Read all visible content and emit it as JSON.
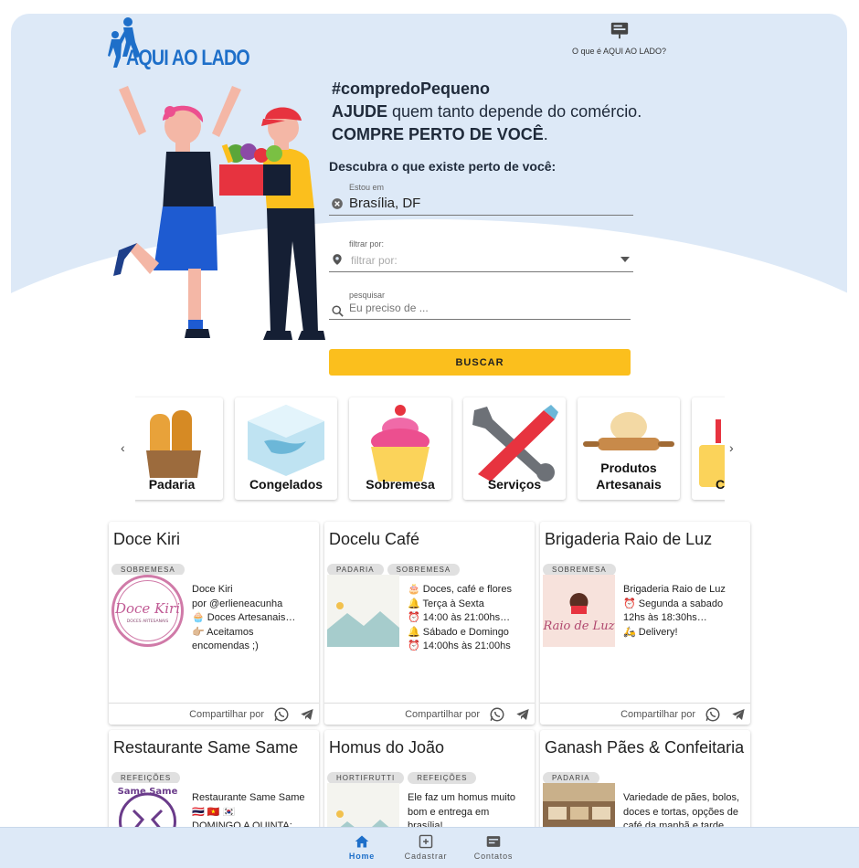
{
  "header": {
    "logo_text": "AQUI AO LADO",
    "about_label": "O que é AQUI AO LADO?"
  },
  "hero": {
    "hashtag": "#compredoPequeno",
    "line2_bold": "AJUDE",
    "line2_rest": " quem tanto depende do comércio.",
    "line3": "COMPRE PERTO DE VOCÊ",
    "line3_end": ".",
    "discover": "Descubra o que existe perto de você:"
  },
  "search": {
    "location_label": "Estou em",
    "location_value": "Brasília, DF",
    "filter_label": "filtrar por:",
    "filter_placeholder": "filtrar por:",
    "query_label": "pesquisar",
    "query_placeholder": "Eu preciso de ...",
    "button_label": "BUSCAR"
  },
  "categories": [
    {
      "label": "Padaria",
      "icon": "bread-icon"
    },
    {
      "label": "Congelados",
      "icon": "ice-cube-icon"
    },
    {
      "label": "Sobremesa",
      "icon": "cupcake-icon"
    },
    {
      "label": "Serviços",
      "icon": "tools-icon"
    },
    {
      "label": "Produtos Artesanais",
      "icon": "rolling-pin-icon"
    },
    {
      "label": "C",
      "icon": "luggage-icon"
    }
  ],
  "stores": [
    {
      "title": "Doce Kiri",
      "chips": [
        "SOBREMESA"
      ],
      "lines": [
        "Doce Kiri",
        "por @erlieneacunha",
        "🧁 Doces Artesanais…",
        "👉🏼 Aceitamos",
        "encomendas ;)"
      ],
      "logo_text": "Doce Kiri",
      "logo_sub": "DOCES ARTESANAIS"
    },
    {
      "title": "Docelu Café",
      "chips": [
        "PADARIA",
        "SOBREMESA"
      ],
      "lines": [
        "🎂 Doces, café e flores",
        "🔔 Terça à Sexta",
        "⏰ 14:00 às 21:00hs…",
        "🔔 Sábado e Domingo",
        "⏰ 14:00hs às 21:00hs"
      ]
    },
    {
      "title": "Brigaderia Raio de Luz",
      "chips": [
        "SOBREMESA"
      ],
      "lines": [
        "Brigaderia Raio de Luz",
        "⏰ Segunda a sabado",
        "12hs às 18:30hs…",
        "🛵 Delivery!"
      ],
      "logo_text": "Raio de Luz"
    },
    {
      "title": "Restaurante Same Same",
      "chips": [
        "REFEIÇÕES"
      ],
      "lines": [
        "Restaurante Same Same",
        "🇹🇭 🇻🇳 🇰🇷",
        "DOMINGO A QUINTA:"
      ],
      "logo_text": "Same Same"
    },
    {
      "title": "Homus do João",
      "chips": [
        "HORTIFRUTTI",
        "REFEIÇÕES"
      ],
      "lines": [
        "Ele faz um homus muito",
        "bom e entrega em",
        "brasília!"
      ]
    },
    {
      "title": "Ganash Pães & Confeitaria",
      "chips": [
        "PADARIA"
      ],
      "lines": [
        "Variedade de pães, bolos,",
        "doces e tortas, opções de",
        "café da manhã e tarde…"
      ]
    }
  ],
  "share_label": "Compartilhar por",
  "bottom_nav": [
    {
      "label": "Home",
      "icon": "home-icon",
      "active": true
    },
    {
      "label": "Cadastrar",
      "icon": "add-business-icon",
      "active": false
    },
    {
      "label": "Contatos",
      "icon": "contacts-icon",
      "active": false
    }
  ],
  "colors": {
    "hero_bg": "#dde9f7",
    "accent": "#1e6fc9",
    "button": "#fbbf1d"
  }
}
